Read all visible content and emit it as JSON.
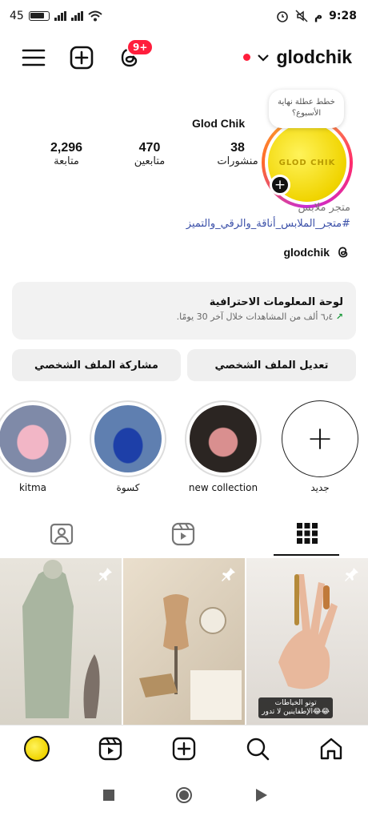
{
  "status": {
    "time": "9:28",
    "am_pm": "م",
    "battery_percent": "45"
  },
  "header": {
    "username": "glodchik",
    "notification_count": "9+"
  },
  "profile": {
    "display_name": "Glod Chik",
    "note": "خطط عطلة نهاية الأسبوع؟",
    "avatar_text": "GLOD CHIK",
    "stats": [
      {
        "value": "38",
        "label": "منشورات"
      },
      {
        "value": "470",
        "label": "متابعين"
      },
      {
        "value": "2,296",
        "label": "متابعة"
      }
    ],
    "category": "متجر ملابس",
    "hashtags": "#متجر_الملابس_أناقة_والرقي_والتميز",
    "threads_handle": "glodchik"
  },
  "dashboard": {
    "title": "لوحة المعلومات الاحترافية",
    "subtitle": "٦٫٤ ألف من المشاهدات خلال آخر 30 يومًا."
  },
  "buttons": {
    "edit_profile": "تعديل الملف الشخصي",
    "share_profile": "مشاركة الملف الشخصي"
  },
  "highlights": [
    {
      "label": "جديد",
      "type": "new"
    },
    {
      "label": "new collection"
    },
    {
      "label": "كسوة"
    },
    {
      "label": "kitma"
    }
  ],
  "posts": [
    {
      "caption": ""
    },
    {
      "caption": ""
    },
    {
      "caption": "تونو الخياطات\nالإطفاينين لا تدور😂😂"
    }
  ],
  "colors": {
    "accent_red": "#ff1e3c",
    "link_blue": "#3a4fa8",
    "button_bg": "#efefef"
  }
}
